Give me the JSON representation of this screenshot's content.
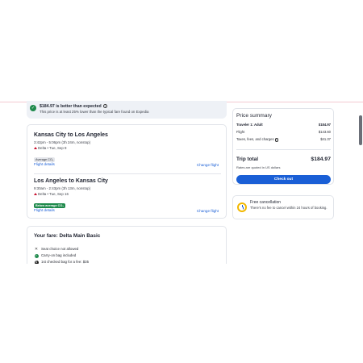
{
  "banner": {
    "title": "$184.97 is better than expected",
    "subtitle": "This price is at least 25% lower than the typical fare found on Expedia",
    "check_icon": "check-circle-icon",
    "info_icon": "info-icon"
  },
  "flights": [
    {
      "route": "Kansas City to Los Angeles",
      "times": "3:42pm - 5:06pm (3h 24m, nonstop)",
      "airline_date": "Delta • Tue, Sep 9",
      "co2_badge": "Average CO₂",
      "details_link": "Flight details",
      "change_link": "Change flight"
    },
    {
      "route": "Los Angeles to Kansas City",
      "times": "9:30am - 2:43pm (3h 13m, nonstop)",
      "airline_date": "Delta • Tue, Sep 16",
      "co2_badge": "Below average CO₂",
      "details_link": "Flight details",
      "change_link": "Change flight"
    }
  ],
  "fare": {
    "title": "Your fare: Delta Main Basic",
    "features": [
      {
        "icon": "x-icon",
        "text": "Seat choice not allowed"
      },
      {
        "icon": "check-icon",
        "text": "Carry-on bag included"
      },
      {
        "icon": "fee-icon",
        "text": "1st checked bag for a fee: $35"
      }
    ]
  },
  "price_summary": {
    "title": "Price summary",
    "traveler_label": "Traveler 1: Adult",
    "traveler_value": "$184.97",
    "flight_label": "Flight",
    "flight_value": "$143.60",
    "taxes_label": "Taxes, fees, and charges",
    "taxes_value": "$41.37",
    "total_label": "Trip total",
    "total_value": "$184.97",
    "currency_note": "Rates are quoted in US dollars",
    "checkout_label": "Check out"
  },
  "cancellation": {
    "title": "Free cancellation",
    "text": "There's no fee to cancel within 24 hours of booking."
  },
  "colors": {
    "accent": "#1a5fd6",
    "success": "#1f8a4c",
    "delta_red": "#c8102e",
    "clock_yellow": "#f2b800"
  }
}
